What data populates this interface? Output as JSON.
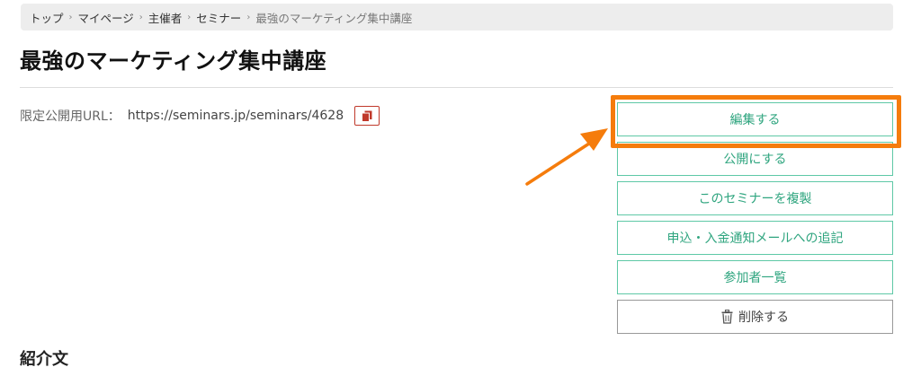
{
  "breadcrumb": {
    "items": [
      "トップ",
      "マイページ",
      "主催者",
      "セミナー"
    ],
    "current": "最強のマーケティング集中講座",
    "separator": "›"
  },
  "page": {
    "title": "最強のマーケティング集中講座"
  },
  "url_row": {
    "label": "限定公開用URL：",
    "value": "https://seminars.jp/seminars/4628",
    "copy_icon": "copy-icon"
  },
  "actions": {
    "edit": "編集する",
    "publish": "公開にする",
    "duplicate": "このセミナーを複製",
    "append_mail": "申込・入金通知メールへの追記",
    "participants": "参加者一覧",
    "delete": "削除する"
  },
  "sections": {
    "intro_heading": "紹介文"
  },
  "colors": {
    "accent_green": "#2fa57f",
    "highlight_orange": "#f57c0c",
    "copy_red": "#c0392b"
  }
}
